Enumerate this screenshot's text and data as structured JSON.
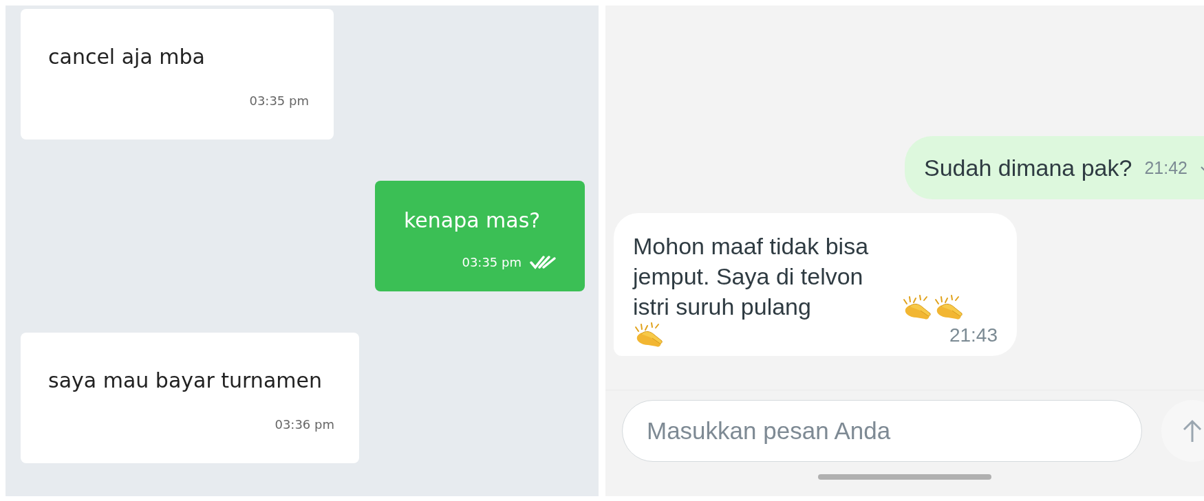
{
  "left_chat": {
    "messages": [
      {
        "kind": "received",
        "text": "cancel aja mba",
        "time": "03:35 pm"
      },
      {
        "kind": "sent",
        "text": "kenapa mas?",
        "time": "03:35 pm",
        "read": true
      },
      {
        "kind": "received",
        "text": "saya mau bayar turnamen",
        "time": "03:36 pm"
      }
    ]
  },
  "right_chat": {
    "messages": [
      {
        "kind": "sent",
        "text": "Sudah dimana pak?",
        "time": "21:42",
        "delivered": true
      },
      {
        "kind": "received",
        "text": "Mohon maaf tidak bisa jemput. Saya di telvon istri suruh pulang",
        "emojis": [
          {
            "kind": "clap"
          },
          {
            "kind": "clap"
          },
          {
            "kind": "clap"
          }
        ],
        "time": "21:43"
      }
    ],
    "composer": {
      "placeholder": "Masukkan pesan Anda"
    }
  }
}
